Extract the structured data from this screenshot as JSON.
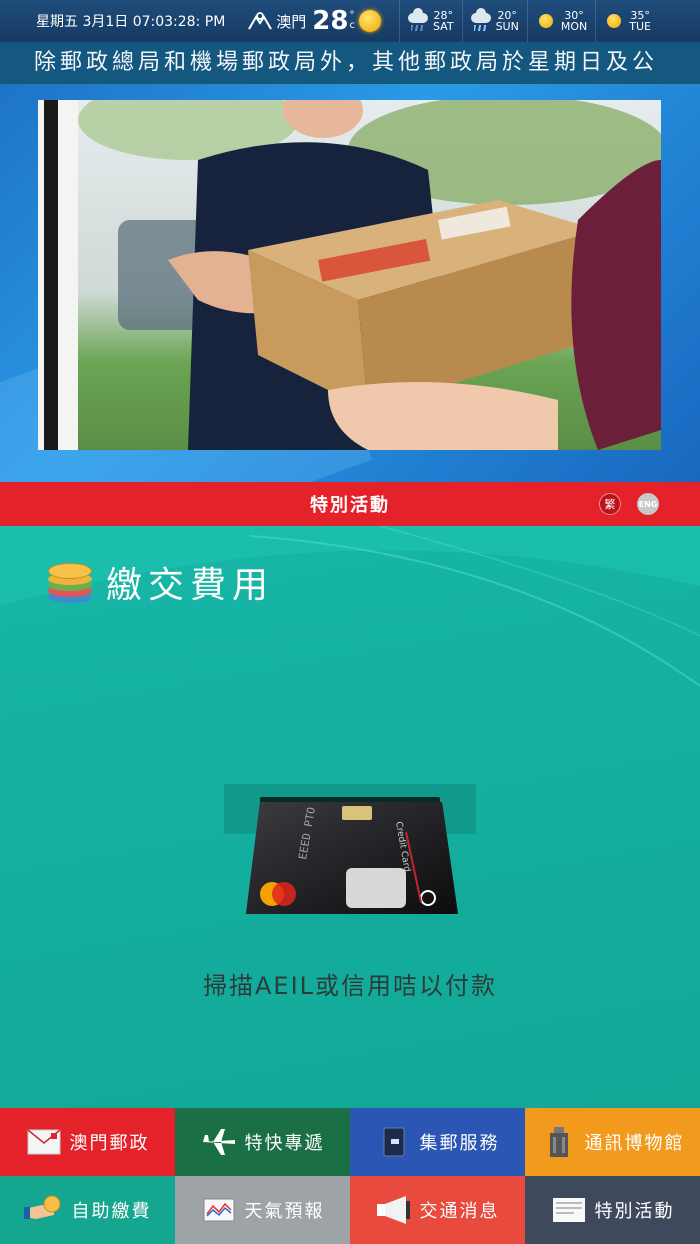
{
  "status": {
    "datetime": "星期五 3月1日  07:03:28: PM",
    "location": "澳門",
    "current_temp": "28",
    "unit_deg": "°",
    "unit_c": "c",
    "forecast": [
      {
        "temp": "28°",
        "day": "SAT",
        "icon": "cloud-icon"
      },
      {
        "temp": "20°",
        "day": "SUN",
        "icon": "rain-cloud-icon"
      },
      {
        "temp": "30°",
        "day": "MON",
        "icon": "sun-icon"
      },
      {
        "temp": "35°",
        "day": "TUE",
        "icon": "sun-icon"
      }
    ]
  },
  "marquee": {
    "text": "除郵政總局和機場郵政局外，其他郵政局於星期日及公"
  },
  "header": {
    "title": "特別活動",
    "lang_tc": "繁",
    "lang_en": "ENG"
  },
  "main": {
    "title": "繳交費用",
    "instruction": "掃描AEIL或信用咭以付款",
    "card_text": {
      "brand": "Credit Card",
      "number": "EEED PTO EEED"
    }
  },
  "nav": [
    {
      "label": "澳門郵政",
      "icon": "envelope-icon"
    },
    {
      "label": "特快專遞",
      "icon": "airplane-icon"
    },
    {
      "label": "集郵服務",
      "icon": "stamp-book-icon"
    },
    {
      "label": "通訊博物館",
      "icon": "museum-icon"
    },
    {
      "label": "自助繳費",
      "icon": "hand-coin-icon"
    },
    {
      "label": "天氣預報",
      "icon": "weather-chart-icon"
    },
    {
      "label": "交通消息",
      "icon": "megaphone-icon"
    },
    {
      "label": "特別活動",
      "icon": "notice-icon"
    }
  ],
  "colors": {
    "red": "#e3222a",
    "teal": "#14b1a0",
    "navy": "#163a62"
  }
}
